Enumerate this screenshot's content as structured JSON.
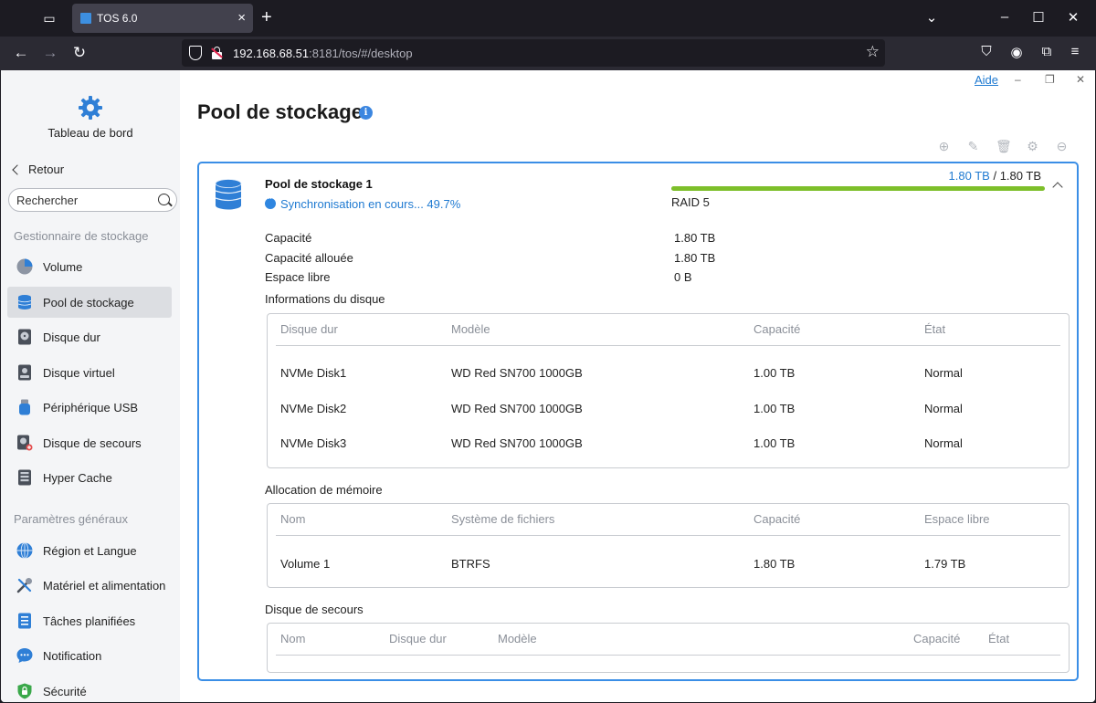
{
  "browser": {
    "tab_title": "TOS 6.0",
    "url_host": "192.168.68.51",
    "url_rest": ":8181/tos/#/desktop"
  },
  "app": {
    "help_label": "Aide"
  },
  "sidebar": {
    "dashboard_label": "Tableau de bord",
    "back_label": "Retour",
    "search_placeholder": "Rechercher",
    "section_storage": "Gestionnaire de stockage",
    "section_general": "Paramètres généraux",
    "items": [
      {
        "label": "Volume",
        "icon": "pie-icon",
        "active": false
      },
      {
        "label": "Pool de stockage",
        "icon": "database-icon",
        "active": true
      },
      {
        "label": "Disque dur",
        "icon": "hard-disk-icon",
        "active": false
      },
      {
        "label": "Disque virtuel",
        "icon": "virtual-disk-icon",
        "active": false
      },
      {
        "label": "Périphérique USB",
        "icon": "usb-icon",
        "active": false
      },
      {
        "label": "Disque de secours",
        "icon": "spare-disk-icon",
        "active": false
      },
      {
        "label": "Hyper Cache",
        "icon": "cache-icon",
        "active": false
      },
      {
        "label": "Région et Langue",
        "icon": "globe-icon",
        "active": false
      },
      {
        "label": "Matériel et alimentation",
        "icon": "tools-icon",
        "active": false
      },
      {
        "label": "Tâches planifiées",
        "icon": "tasks-icon",
        "active": false
      },
      {
        "label": "Notification",
        "icon": "chat-icon",
        "active": false
      },
      {
        "label": "Sécurité",
        "icon": "shield-lock-icon",
        "active": false
      }
    ]
  },
  "main": {
    "page_title": "Pool de stockage",
    "pool": {
      "name": "Pool de stockage 1",
      "sync_status": "Synchronisation en cours... 49.7%",
      "used": "1.80 TB",
      "separator": "/",
      "total": "1.80 TB",
      "usage_fraction": 1.0,
      "raid": "RAID 5",
      "capacity_label": "Capacité",
      "capacity_value": "1.80 TB",
      "allocated_label": "Capacité allouée",
      "allocated_value": "1.80 TB",
      "free_label": "Espace libre",
      "free_value": "0 B"
    },
    "disk_info": {
      "title": "Informations du disque",
      "headers": [
        "Disque dur",
        "Modèle",
        "Capacité",
        "État"
      ],
      "rows": [
        [
          "NVMe Disk1",
          "WD Red SN700 1000GB",
          "1.00 TB",
          "Normal"
        ],
        [
          "NVMe Disk2",
          "WD Red SN700 1000GB",
          "1.00 TB",
          "Normal"
        ],
        [
          "NVMe Disk3",
          "WD Red SN700 1000GB",
          "1.00 TB",
          "Normal"
        ]
      ]
    },
    "memory_alloc": {
      "title": "Allocation de mémoire",
      "headers": [
        "Nom",
        "Système de fichiers",
        "Capacité",
        "Espace libre"
      ],
      "rows": [
        [
          "Volume 1",
          "BTRFS",
          "1.80 TB",
          "1.79 TB"
        ]
      ]
    },
    "spare_disk": {
      "title": "Disque de secours",
      "headers": [
        "Nom",
        "Disque dur",
        "Modèle",
        "Capacité",
        "État"
      ]
    }
  },
  "colors": {
    "accent": "#3a8ee6",
    "progress": "#7dbf2a",
    "link": "#1f7ad1"
  }
}
